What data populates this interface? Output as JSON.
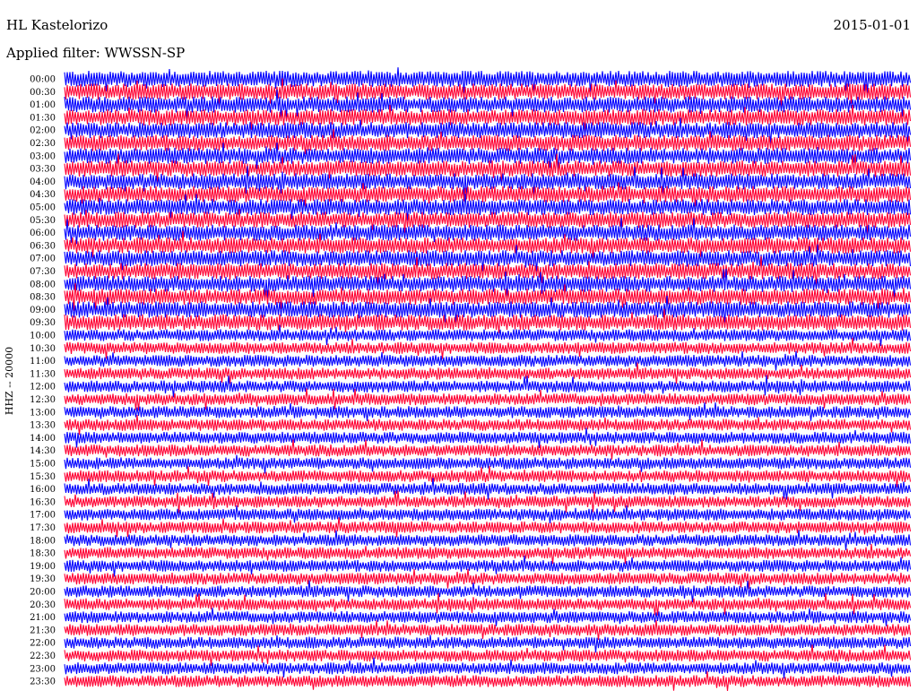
{
  "header": {
    "station": "HL Kastelorizo",
    "date": "2015-01-01",
    "filter_label": "Applied filter: WWSSN-SP"
  },
  "chart_data": {
    "type": "line",
    "title": "HL Kastelorizo",
    "date": "2015-01-01",
    "filter": "Applied filter: WWSSN-SP",
    "ylabel": "HHZ -- 20000",
    "row_labels": [
      "00:00",
      "00:30",
      "01:00",
      "01:30",
      "02:00",
      "02:30",
      "03:00",
      "03:30",
      "04:00",
      "04:30",
      "05:00",
      "05:30",
      "06:00",
      "06:30",
      "07:00",
      "07:30",
      "08:00",
      "08:30",
      "09:00",
      "09:30",
      "10:00",
      "10:30",
      "11:00",
      "11:30",
      "12:00",
      "12:30",
      "13:00",
      "13:30",
      "14:00",
      "14:30",
      "15:00",
      "15:30",
      "16:00",
      "16:30",
      "17:00",
      "17:30",
      "18:00",
      "18:30",
      "19:00",
      "19:30",
      "20:00",
      "20:30",
      "21:00",
      "21:30",
      "22:00",
      "22:30",
      "23:00",
      "23:30"
    ],
    "trace_colors": [
      "#0000ff",
      "#ff0033"
    ],
    "grid": false,
    "legend": "none"
  }
}
